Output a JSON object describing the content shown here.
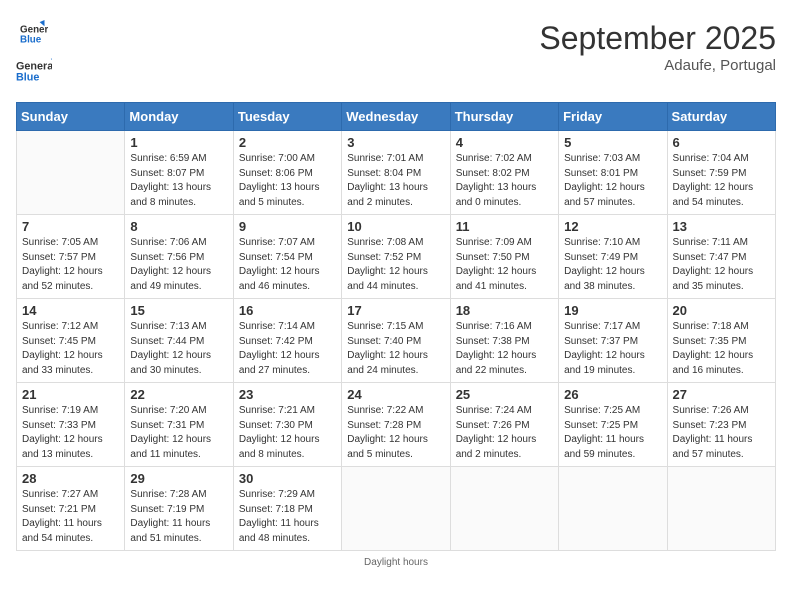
{
  "header": {
    "logo_general": "General",
    "logo_blue": "Blue",
    "title": "September 2025",
    "subtitle": "Adaufe, Portugal"
  },
  "columns": [
    "Sunday",
    "Monday",
    "Tuesday",
    "Wednesday",
    "Thursday",
    "Friday",
    "Saturday"
  ],
  "weeks": [
    [
      {
        "day": "",
        "sunrise": "",
        "sunset": "",
        "daylight": ""
      },
      {
        "day": "1",
        "sunrise": "Sunrise: 6:59 AM",
        "sunset": "Sunset: 8:07 PM",
        "daylight": "Daylight: 13 hours and 8 minutes."
      },
      {
        "day": "2",
        "sunrise": "Sunrise: 7:00 AM",
        "sunset": "Sunset: 8:06 PM",
        "daylight": "Daylight: 13 hours and 5 minutes."
      },
      {
        "day": "3",
        "sunrise": "Sunrise: 7:01 AM",
        "sunset": "Sunset: 8:04 PM",
        "daylight": "Daylight: 13 hours and 2 minutes."
      },
      {
        "day": "4",
        "sunrise": "Sunrise: 7:02 AM",
        "sunset": "Sunset: 8:02 PM",
        "daylight": "Daylight: 13 hours and 0 minutes."
      },
      {
        "day": "5",
        "sunrise": "Sunrise: 7:03 AM",
        "sunset": "Sunset: 8:01 PM",
        "daylight": "Daylight: 12 hours and 57 minutes."
      },
      {
        "day": "6",
        "sunrise": "Sunrise: 7:04 AM",
        "sunset": "Sunset: 7:59 PM",
        "daylight": "Daylight: 12 hours and 54 minutes."
      }
    ],
    [
      {
        "day": "7",
        "sunrise": "Sunrise: 7:05 AM",
        "sunset": "Sunset: 7:57 PM",
        "daylight": "Daylight: 12 hours and 52 minutes."
      },
      {
        "day": "8",
        "sunrise": "Sunrise: 7:06 AM",
        "sunset": "Sunset: 7:56 PM",
        "daylight": "Daylight: 12 hours and 49 minutes."
      },
      {
        "day": "9",
        "sunrise": "Sunrise: 7:07 AM",
        "sunset": "Sunset: 7:54 PM",
        "daylight": "Daylight: 12 hours and 46 minutes."
      },
      {
        "day": "10",
        "sunrise": "Sunrise: 7:08 AM",
        "sunset": "Sunset: 7:52 PM",
        "daylight": "Daylight: 12 hours and 44 minutes."
      },
      {
        "day": "11",
        "sunrise": "Sunrise: 7:09 AM",
        "sunset": "Sunset: 7:50 PM",
        "daylight": "Daylight: 12 hours and 41 minutes."
      },
      {
        "day": "12",
        "sunrise": "Sunrise: 7:10 AM",
        "sunset": "Sunset: 7:49 PM",
        "daylight": "Daylight: 12 hours and 38 minutes."
      },
      {
        "day": "13",
        "sunrise": "Sunrise: 7:11 AM",
        "sunset": "Sunset: 7:47 PM",
        "daylight": "Daylight: 12 hours and 35 minutes."
      }
    ],
    [
      {
        "day": "14",
        "sunrise": "Sunrise: 7:12 AM",
        "sunset": "Sunset: 7:45 PM",
        "daylight": "Daylight: 12 hours and 33 minutes."
      },
      {
        "day": "15",
        "sunrise": "Sunrise: 7:13 AM",
        "sunset": "Sunset: 7:44 PM",
        "daylight": "Daylight: 12 hours and 30 minutes."
      },
      {
        "day": "16",
        "sunrise": "Sunrise: 7:14 AM",
        "sunset": "Sunset: 7:42 PM",
        "daylight": "Daylight: 12 hours and 27 minutes."
      },
      {
        "day": "17",
        "sunrise": "Sunrise: 7:15 AM",
        "sunset": "Sunset: 7:40 PM",
        "daylight": "Daylight: 12 hours and 24 minutes."
      },
      {
        "day": "18",
        "sunrise": "Sunrise: 7:16 AM",
        "sunset": "Sunset: 7:38 PM",
        "daylight": "Daylight: 12 hours and 22 minutes."
      },
      {
        "day": "19",
        "sunrise": "Sunrise: 7:17 AM",
        "sunset": "Sunset: 7:37 PM",
        "daylight": "Daylight: 12 hours and 19 minutes."
      },
      {
        "day": "20",
        "sunrise": "Sunrise: 7:18 AM",
        "sunset": "Sunset: 7:35 PM",
        "daylight": "Daylight: 12 hours and 16 minutes."
      }
    ],
    [
      {
        "day": "21",
        "sunrise": "Sunrise: 7:19 AM",
        "sunset": "Sunset: 7:33 PM",
        "daylight": "Daylight: 12 hours and 13 minutes."
      },
      {
        "day": "22",
        "sunrise": "Sunrise: 7:20 AM",
        "sunset": "Sunset: 7:31 PM",
        "daylight": "Daylight: 12 hours and 11 minutes."
      },
      {
        "day": "23",
        "sunrise": "Sunrise: 7:21 AM",
        "sunset": "Sunset: 7:30 PM",
        "daylight": "Daylight: 12 hours and 8 minutes."
      },
      {
        "day": "24",
        "sunrise": "Sunrise: 7:22 AM",
        "sunset": "Sunset: 7:28 PM",
        "daylight": "Daylight: 12 hours and 5 minutes."
      },
      {
        "day": "25",
        "sunrise": "Sunrise: 7:24 AM",
        "sunset": "Sunset: 7:26 PM",
        "daylight": "Daylight: 12 hours and 2 minutes."
      },
      {
        "day": "26",
        "sunrise": "Sunrise: 7:25 AM",
        "sunset": "Sunset: 7:25 PM",
        "daylight": "Daylight: 11 hours and 59 minutes."
      },
      {
        "day": "27",
        "sunrise": "Sunrise: 7:26 AM",
        "sunset": "Sunset: 7:23 PM",
        "daylight": "Daylight: 11 hours and 57 minutes."
      }
    ],
    [
      {
        "day": "28",
        "sunrise": "Sunrise: 7:27 AM",
        "sunset": "Sunset: 7:21 PM",
        "daylight": "Daylight: 11 hours and 54 minutes."
      },
      {
        "day": "29",
        "sunrise": "Sunrise: 7:28 AM",
        "sunset": "Sunset: 7:19 PM",
        "daylight": "Daylight: 11 hours and 51 minutes."
      },
      {
        "day": "30",
        "sunrise": "Sunrise: 7:29 AM",
        "sunset": "Sunset: 7:18 PM",
        "daylight": "Daylight: 11 hours and 48 minutes."
      },
      {
        "day": "",
        "sunrise": "",
        "sunset": "",
        "daylight": ""
      },
      {
        "day": "",
        "sunrise": "",
        "sunset": "",
        "daylight": ""
      },
      {
        "day": "",
        "sunrise": "",
        "sunset": "",
        "daylight": ""
      },
      {
        "day": "",
        "sunrise": "",
        "sunset": "",
        "daylight": ""
      }
    ]
  ]
}
